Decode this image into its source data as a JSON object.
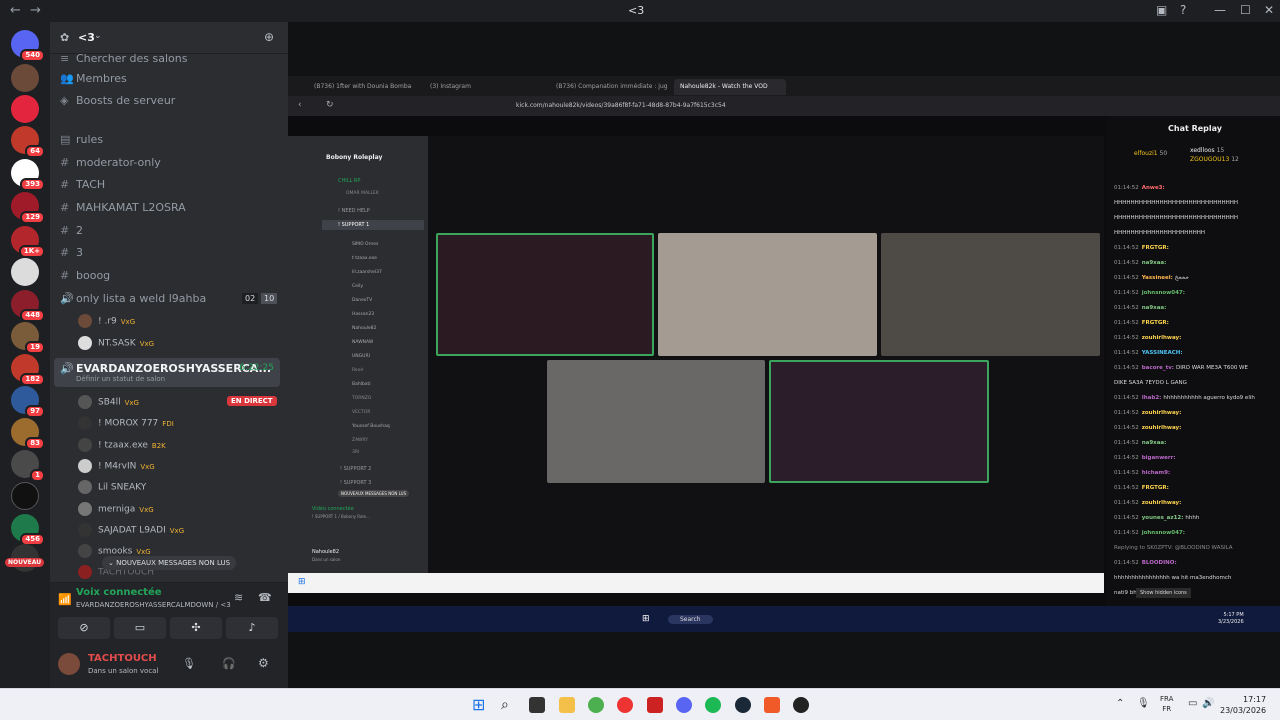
{
  "window": {
    "title": "<3"
  },
  "server": {
    "name": "<3",
    "badges": [
      "540",
      "64",
      "393",
      "129",
      "1K+",
      "448",
      "19",
      "182",
      "97",
      "83",
      "1",
      "456",
      "NOUVEAU"
    ]
  },
  "channels": {
    "search": "Chercher des salons",
    "members": "Membres",
    "boosts": "Boosts de serveur",
    "list": [
      "rules",
      "moderator-only",
      "TACH",
      "MAHKAMAT L2OSRA",
      "2",
      "3",
      "booog"
    ],
    "voice_channel_1": {
      "name": "only lista a weld l9ahba",
      "count_a": "02",
      "count_b": "10",
      "users": [
        "! .r9",
        "NT.SASK"
      ],
      "user_tags": [
        "VxG",
        "VxG"
      ]
    },
    "voice_channel_2": {
      "name": "EVARDANZOEROSHYASSERCA...",
      "timer": "6:22:25",
      "status_hint": "Définir un statut de salon",
      "live_badge": "EN DIRECT",
      "users": [
        "SB4ll",
        "! MOROX 777",
        "! tzaax.exe",
        "! M4rvIN",
        "Lil SNEAKY",
        "merniga",
        "SAJADAT L9ADI",
        "smooks",
        "TACHTOUCH"
      ],
      "user_tags": [
        "VxG",
        "FDI",
        "B2K",
        "VxG",
        "",
        "VxG",
        "VxG",
        "VxG",
        ""
      ]
    },
    "new_messages": "NOUVEAUX MESSAGES NON LUS"
  },
  "voice_panel": {
    "status": "Voix connectée",
    "channel": "EVARDANZOEROSHYASSERCALMDOWN / <3"
  },
  "user_panel": {
    "name": "TACHTOUCH",
    "status": "Dans un salon vocal"
  },
  "browser": {
    "tabs": [
      "(B736) 1fter with Dounia Bomba",
      "(3) Instagram",
      "(B736) Companation immédiate : jug",
      "Nahoule82k - Watch the VOD"
    ],
    "url": "kick.com/nahoule82k/videos/39a86f8f-fa71-48d8-87b4-9a7f615c3c54"
  },
  "inner_discord": {
    "server": "Bobony Roleplay",
    "channels": [
      "CHILL RP",
      "! NEED HELP",
      "! SUPPORT 1",
      "! SUPPORT 2",
      "! SUPPORT 3"
    ],
    "users": [
      "OMAR MALLEK",
      "SIMO Ornes",
      "t tzaax.exe",
      "lil.zaarshel37",
      "Ceily",
      "DanexTV",
      "Hassan23",
      "Nahoule82",
      "NAWNAW",
      "UNGURI",
      "Reolr",
      "Bahlbati",
      "TORNZO",
      "VECTOR",
      "Youssef Boushaq",
      "ZAWRY",
      "3RI"
    ],
    "video_status": "Vidéo connectée",
    "video_channel": "! SUPPORT 1 / Bobony Role...",
    "user": "Nahoule82",
    "user_status": "Dans un salon",
    "new_messages": "NOUVEAUX MESSAGES NON LUS"
  },
  "chat": {
    "title": "Chat Replay",
    "leaders": [
      {
        "name": "elfouzi1",
        "score": "50"
      },
      {
        "name": "xedlloos",
        "score": "15"
      },
      {
        "name": "ZGOUGOU13",
        "score": "12"
      }
    ],
    "messages": [
      {
        "t": "01:14:52",
        "n": "Anwe3:",
        "m": "",
        "c": "#ff6b6b"
      },
      {
        "t": "",
        "n": "",
        "m": "HHHHHHHHHHHHHHHHHHHHHHHHHHHHHH",
        "c": "#dcdcdc"
      },
      {
        "t": "",
        "n": "",
        "m": "HHHHHHHHHHHHHHHHHHHHHHHHHHHHHH",
        "c": "#dcdcdc"
      },
      {
        "t": "",
        "n": "",
        "m": "HHHHHHHHHHHHHHHHHHHHHH",
        "c": "#dcdcdc"
      },
      {
        "t": "01:14:52",
        "n": "FRGTGR:",
        "m": "",
        "c": "#ffd54f"
      },
      {
        "t": "01:14:52",
        "n": "na9xaa:",
        "m": "",
        "c": "#81c784"
      },
      {
        "t": "01:14:52",
        "n": "Yassineel:",
        "m": "خخخخ",
        "c": "#ffb74d"
      },
      {
        "t": "01:14:52",
        "n": "johnsnow047:",
        "m": "",
        "c": "#66bb6a"
      },
      {
        "t": "01:14:52",
        "n": "na9xaa:",
        "m": "",
        "c": "#81c784"
      },
      {
        "t": "01:14:52",
        "n": "FRGTGR:",
        "m": "",
        "c": "#ffd54f"
      },
      {
        "t": "01:14:52",
        "n": "zouhirlhway:",
        "m": "",
        "c": "#ffd54f"
      },
      {
        "t": "01:14:52",
        "n": "YASSINEACH:",
        "m": "",
        "c": "#4fc3f7"
      },
      {
        "t": "01:14:52",
        "n": "bacore_tv:",
        "m": "DIRO WAR ME3A T600 WE",
        "c": "#ba68c8"
      },
      {
        "t": "",
        "n": "",
        "m": "DIKE SA3A 7EYDO L GANG",
        "c": "#dcdcdc"
      },
      {
        "t": "01:14:52",
        "n": "Ihab2:",
        "m": "hhhhhhhhhhh aguerro kydo9 elih",
        "c": "#ba68c8"
      },
      {
        "t": "01:14:52",
        "n": "zouhirlhway:",
        "m": "",
        "c": "#ffd54f"
      },
      {
        "t": "01:14:52",
        "n": "zouhirlhway:",
        "m": "",
        "c": "#ffd54f"
      },
      {
        "t": "01:14:52",
        "n": "na9xaa:",
        "m": "",
        "c": "#81c784"
      },
      {
        "t": "01:14:52",
        "n": "biganwerr:",
        "m": "",
        "c": "#ba68c8"
      },
      {
        "t": "01:14:52",
        "n": "hicham9:",
        "m": "",
        "c": "#ba68c8"
      },
      {
        "t": "01:14:52",
        "n": "FRGTGR:",
        "m": "",
        "c": "#ffd54f"
      },
      {
        "t": "01:14:52",
        "n": "zouhirlhway:",
        "m": "",
        "c": "#ffd54f"
      },
      {
        "t": "01:14:52",
        "n": "younes_az12:",
        "m": "hhhh",
        "c": "#81c784"
      },
      {
        "t": "01:14:52",
        "n": "johnsnow047:",
        "m": "",
        "c": "#66bb6a"
      },
      {
        "t": "",
        "n": "",
        "m": "Replying to SK0ZPTV: @BLOODINO WASILA",
        "c": "#8a8a8a"
      },
      {
        "t": "01:14:52",
        "n": "BLOODINO:",
        "m": "",
        "c": "#ba68c8"
      },
      {
        "t": "",
        "n": "",
        "m": "hhhhhhhhhhhhhhhh wa hit ma3endhomch",
        "c": "#dcdcdc"
      },
      {
        "t": "",
        "n": "",
        "m": "nati9 bhaali",
        "c": "#dcdcdc"
      }
    ],
    "tooltip": "Show hidden icons"
  },
  "stream_taskbar": {
    "search": "Search",
    "time": "5:17 PM",
    "date": "3/23/2026"
  },
  "taskbar": {
    "lang1": "FRA",
    "lang2": "FR",
    "time": "17:17",
    "date": "23/03/2026"
  },
  "colors": {
    "discord_bg": "#2b2d31",
    "rail_bg": "#1e1f22",
    "accent": "#5865f2",
    "live": "#da373c",
    "voice_green": "#23a55a"
  }
}
